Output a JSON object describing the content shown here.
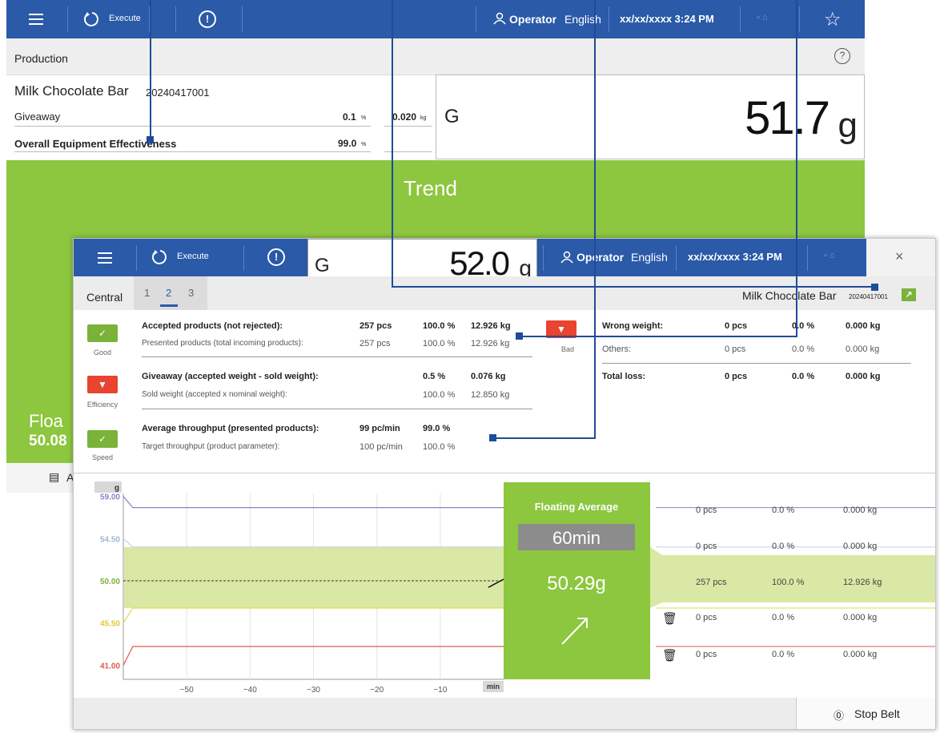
{
  "colors": {
    "header_blue": "#2a5aa8",
    "trend_green": "#8dc63f",
    "good_green": "#7ab23a",
    "bad_red": "#e8442f",
    "tolerance_band": "#d9e8a4",
    "line_upper": "#8a82c6",
    "line_lower": "#e05a4c"
  },
  "background_window": {
    "header": {
      "execute_label": "Execute",
      "operator_bold": "Operator",
      "operator_lang": "English",
      "datetime": "xx/xx/xxxx 3:24 PM"
    },
    "subbar_title": "Production",
    "product_name": "Milk Chocolate Bar",
    "batch_id": "20240417001",
    "giveaway_label": "Giveaway",
    "giveaway_pct": "0.1",
    "giveaway_pct_unit": "%",
    "giveaway_kg": "0.020",
    "giveaway_kg_unit": "kg",
    "oee_label": "Overall Equipment Effectiveness",
    "oee_pct": "99.0",
    "oee_pct_unit": "%",
    "weight_prefix": "G",
    "weight_value": "51.7",
    "weight_unit": "g",
    "trend_title": "Trend",
    "floating_partial": "Floa",
    "floating_value_partial": "50.08",
    "footer_letter": "A"
  },
  "front_window": {
    "header": {
      "execute_label": "Execute",
      "operator_bold": "Operator",
      "operator_lang": "English",
      "datetime": "xx/xx/xxxx 3:24 PM"
    },
    "weight_prefix": "G",
    "weight_value": "52.0",
    "weight_unit": "g",
    "tabs": {
      "central": "Central",
      "t1": "1",
      "t2": "2",
      "t3": "3",
      "active": "2"
    },
    "product_name": "Milk Chocolate Bar",
    "batch_id": "20240417001",
    "good": {
      "caption": "Good",
      "rows": [
        {
          "label": "Accepted products (not rejected):",
          "pcs": "257 pcs",
          "pct": "100.0 %",
          "kg": "12.926 kg"
        },
        {
          "label": "Presented products (total incoming products):",
          "pcs": "257 pcs",
          "pct": "100.0 %",
          "kg": "12.926 kg"
        }
      ]
    },
    "efficiency": {
      "caption": "Efficiency",
      "rows": [
        {
          "label": "Giveaway (accepted weight - sold weight):",
          "pct": "0.5 %",
          "kg": "0.076 kg"
        },
        {
          "label": "Sold weight (accepted x nominal weight):",
          "pct": "100.0 %",
          "kg": "12.850 kg"
        }
      ]
    },
    "speed": {
      "caption": "Speed",
      "rows": [
        {
          "label": "Average throughput (presented products):",
          "rate": "99 pc/min",
          "pct": "99.0 %"
        },
        {
          "label": "Target throughput (product parameter):",
          "rate": "100 pc/min",
          "pct": "100.0 %"
        }
      ]
    },
    "bad": {
      "caption": "Bad",
      "rows": [
        {
          "label": "Wrong weight:",
          "pcs": "0 pcs",
          "pct": "0.0 %",
          "kg": "0.000 kg"
        },
        {
          "label": "Others:",
          "pcs": "0 pcs",
          "pct": "0.0 %",
          "kg": "0.000 kg"
        },
        {
          "label": "Total loss:",
          "pcs": "0 pcs",
          "pct": "0.0 %",
          "kg": "0.000 kg"
        }
      ]
    },
    "floating": {
      "title": "Floating Average",
      "window": "60min",
      "value": "50.29g"
    },
    "zones": [
      {
        "pcs": "0 pcs",
        "pct": "0.0 %",
        "kg": "0.000 kg"
      },
      {
        "pcs": "0 pcs",
        "pct": "0.0 %",
        "kg": "0.000 kg"
      },
      {
        "pcs": "257 pcs",
        "pct": "100.0 %",
        "kg": "12.926 kg"
      },
      {
        "pcs": "0 pcs",
        "pct": "0.0 %",
        "kg": "0.000 kg"
      },
      {
        "pcs": "0 pcs",
        "pct": "0.0 %",
        "kg": "0.000 kg"
      }
    ],
    "stop_belt_icon": "⓪",
    "stop_belt_label": "Stop Belt"
  },
  "chart_data": {
    "type": "line",
    "ylabel": "g",
    "xlabel": "min",
    "x_ticks": [
      -50,
      -40,
      -30,
      -20,
      -10
    ],
    "y_ticks": [
      "59.00",
      "54.50",
      "50.00",
      "45.50",
      "41.00"
    ],
    "y_tick_values": [
      59.0,
      54.5,
      50.0,
      45.5,
      41.0
    ],
    "series": [
      {
        "values": [
          [
            -60,
            59.0
          ],
          [
            -58.5,
            57.8
          ],
          [
            0,
            57.8
          ]
        ],
        "color": "#8a82c6"
      },
      {
        "values": [
          [
            -60,
            54.5
          ],
          [
            -58.5,
            53.6
          ],
          [
            0,
            53.6
          ]
        ],
        "color": "#c0d0e8"
      },
      {
        "values": [
          [
            -60,
            45.5
          ],
          [
            -58.5,
            47.1
          ],
          [
            0,
            47.1
          ]
        ],
        "color": "#e6d84a"
      },
      {
        "values": [
          [
            -60,
            41.0
          ],
          [
            -58.5,
            43.0
          ],
          [
            0,
            43.0
          ]
        ],
        "color": "#e05a4c"
      }
    ],
    "nominal": 50.0,
    "tolerance_band": [
      47.1,
      53.6
    ],
    "xlim": [
      -60,
      0
    ],
    "ylim": [
      39.5,
      60.5
    ]
  }
}
